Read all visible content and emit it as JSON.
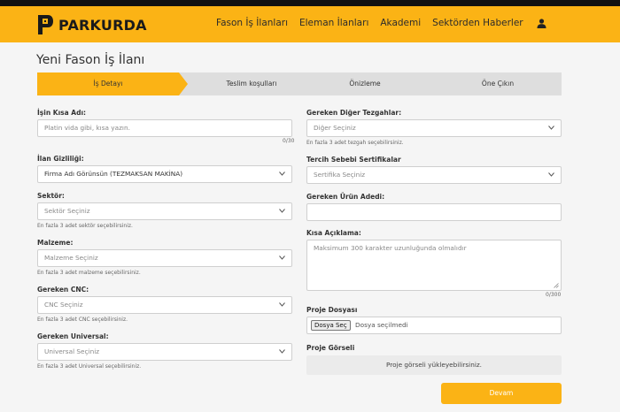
{
  "brand": {
    "name": "PARKURDA",
    "accent": "#fbb315"
  },
  "nav": {
    "items": [
      "Fason İş İlanları",
      "Eleman İlanları",
      "Akademi",
      "Sektörden Haberler"
    ],
    "user_icon": "user-icon"
  },
  "page": {
    "title": "Yeni Fason İş İlanı"
  },
  "steps": [
    "İş Detayı",
    "Teslim koşulları",
    "Önizleme",
    "Öne Çıkın"
  ],
  "form": {
    "job_title": {
      "label": "İşin Kısa Adı:",
      "placeholder": "Platin vida gibi, kısa yazın.",
      "counter": "0/30"
    },
    "visibility": {
      "label": "İlan Gizliliği:",
      "value": "Firma Adı Görünsün (TEZMAKSAN MAKİNA)"
    },
    "sector": {
      "label": "Sektör:",
      "placeholder": "Sektör Seçiniz",
      "help": "En fazla 3 adet sektör seçebilirsiniz."
    },
    "material": {
      "label": "Malzeme:",
      "placeholder": "Malzeme Seçiniz",
      "help": "En fazla 3 adet malzeme seçebilirsiniz."
    },
    "cnc": {
      "label": "Gereken CNC:",
      "placeholder": "CNC Seçiniz",
      "help": "En fazla 3 adet CNC seçebilirsiniz."
    },
    "universal": {
      "label": "Gereken Universal:",
      "placeholder": "Universal Seçiniz",
      "help": "En fazla 3 adet Universal seçebilirsiniz."
    },
    "other_benches": {
      "label": "Gereken Diğer Tezgahlar:",
      "placeholder": "Diğer Seçiniz",
      "help": "En fazla 3 adet tezgah seçebilirsiniz."
    },
    "certificates": {
      "label": "Tercih Sebebi Sertifikalar",
      "placeholder": "Sertifika Seçiniz"
    },
    "quantity": {
      "label": "Gereken Ürün Adedi:",
      "value": ""
    },
    "description": {
      "label": "Kısa Açıklama:",
      "placeholder": "Maksimum 300 karakter uzunluğunda olmalıdır",
      "counter": "0/300"
    },
    "project_file": {
      "label": "Proje Dosyası",
      "button": "Dosya Seç",
      "status": "Dosya seçilmedi"
    },
    "project_image": {
      "label": "Proje Görseli",
      "hint": "Proje görseli yükleyebilirsiniz."
    },
    "submit": "Devam"
  }
}
